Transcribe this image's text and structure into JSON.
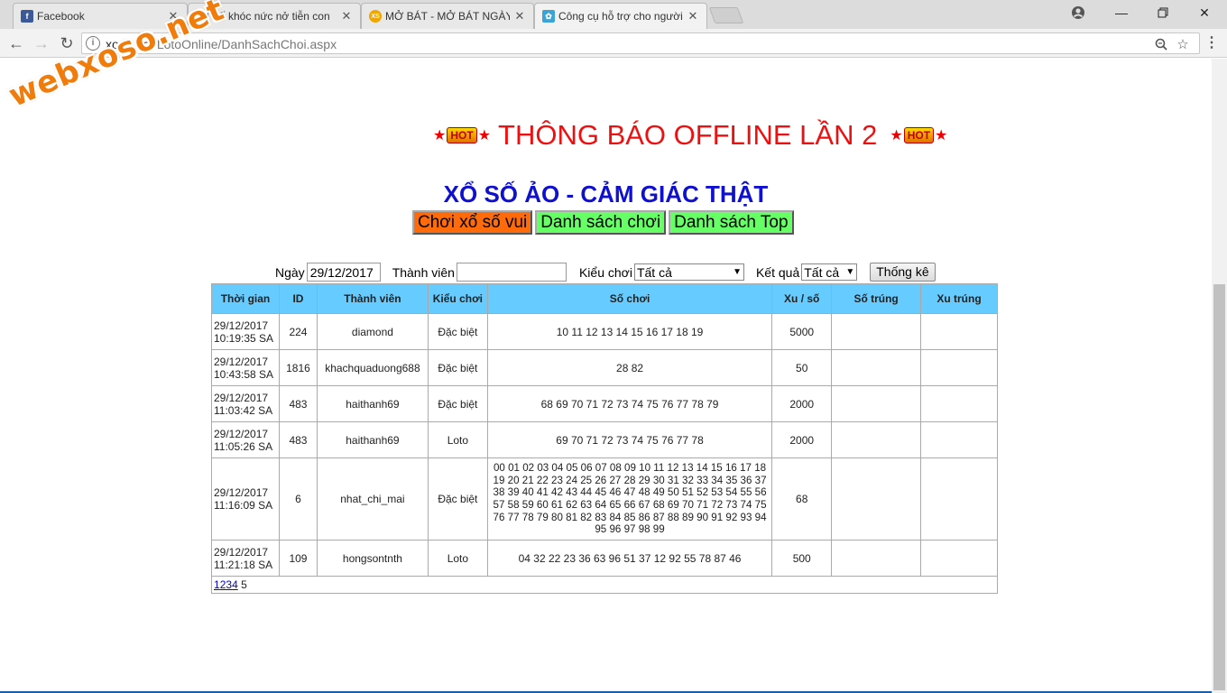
{
  "browser": {
    "tabs": [
      {
        "title": "Facebook",
        "favicon_text": "f",
        "favicon_color": "#3b5998"
      },
      {
        "title": "Bố khóc nức nở tiễn con",
        "favicon_text": "B",
        "favicon_color": "#4a6fa8"
      },
      {
        "title": "MỞ BÁT - MỞ BÁT NGÀY",
        "favicon_text": "XS",
        "favicon_color": "#f0a500"
      },
      {
        "title": "Công cụ hỗ trợ cho người",
        "favicon_text": "✿",
        "favicon_color": "#3aa3d8"
      }
    ],
    "url_host": "xoso.net",
    "url_path": "/LotoOnline/DanhSachChoi.aspx",
    "watermark": "webxoso.net"
  },
  "page": {
    "announcement": "THÔNG BÁO OFFLINE LẦN 2",
    "hot_label": "HOT",
    "subtitle": "XỔ SỐ ẢO - CẢM GIÁC THẬT",
    "nav": {
      "play": "Chơi xổ số vui",
      "list": "Danh sách chơi",
      "top": "Danh sách Top"
    },
    "filters": {
      "date_label": "Ngày",
      "date_value": "29/12/2017",
      "member_label": "Thành viên",
      "member_value": "",
      "type_label": "Kiểu chơi",
      "type_value": "Tất cả",
      "result_label": "Kết quả",
      "result_value": "Tất cả",
      "submit": "Thống kê"
    },
    "table": {
      "headers": [
        "Thời gian",
        "ID",
        "Thành viên",
        "Kiểu chơi",
        "Số chơi",
        "Xu / số",
        "Số trúng",
        "Xu trúng"
      ],
      "rows": [
        {
          "date": "29/12/2017",
          "time": "10:19:35 SA",
          "id": "224",
          "member": "diamond",
          "type": "Đặc biệt",
          "numbers": "10 11 12 13 14 15 16 17 18 19",
          "xu": "5000",
          "hit": "",
          "xu_hit": ""
        },
        {
          "date": "29/12/2017",
          "time": "10:43:58 SA",
          "id": "1816",
          "member": "khachquaduong688",
          "type": "Đặc biệt",
          "numbers": "28 82",
          "xu": "50",
          "hit": "",
          "xu_hit": ""
        },
        {
          "date": "29/12/2017",
          "time": "11:03:42 SA",
          "id": "483",
          "member": "haithanh69",
          "type": "Đặc biệt",
          "numbers": "68 69 70 71 72 73 74 75 76 77 78 79",
          "xu": "2000",
          "hit": "",
          "xu_hit": ""
        },
        {
          "date": "29/12/2017",
          "time": "11:05:26 SA",
          "id": "483",
          "member": "haithanh69",
          "type": "Loto",
          "numbers": "69 70 71 72 73 74 75 76 77 78",
          "xu": "2000",
          "hit": "",
          "xu_hit": ""
        },
        {
          "date": "29/12/2017",
          "time": "11:16:09 SA",
          "id": "6",
          "member": "nhat_chi_mai",
          "type": "Đặc biệt",
          "numbers": "00 01 02 03 04 05 06 07 08 09 10 11 12 13 14 15 16 17 18 19 20 21 22 23 24 25 26 27 28 29 30 31 32 33 34 35 36 37 38 39 40 41 42 43 44 45 46 47 48 49 50 51 52 53 54 55 56 57 58 59 60 61 62 63 64 65 66 67 68 69 70 71 72 73 74 75 76 77 78 79 80 81 82 83 84 85 86 87 88 89 90 91 92 93 94 95 96 97 98 99",
          "xu": "68",
          "hit": "",
          "xu_hit": ""
        },
        {
          "date": "29/12/2017",
          "time": "11:21:18 SA",
          "id": "109",
          "member": "hongsontnth",
          "type": "Loto",
          "numbers": "04 32 22 23 36 63 96 51 37 12 92 55 78 87 46",
          "xu": "500",
          "hit": "",
          "xu_hit": ""
        }
      ],
      "pages": [
        "1",
        "2",
        "3",
        "4"
      ],
      "current_page": "5"
    }
  },
  "colors": {
    "announce_red": "#ee1010",
    "subtitle_blue": "#1010d0",
    "header_blue": "#66ccff",
    "play_orange": "#ff6a0a",
    "nav_green": "#66ff66",
    "watermark_orange": "#f07c0c"
  }
}
